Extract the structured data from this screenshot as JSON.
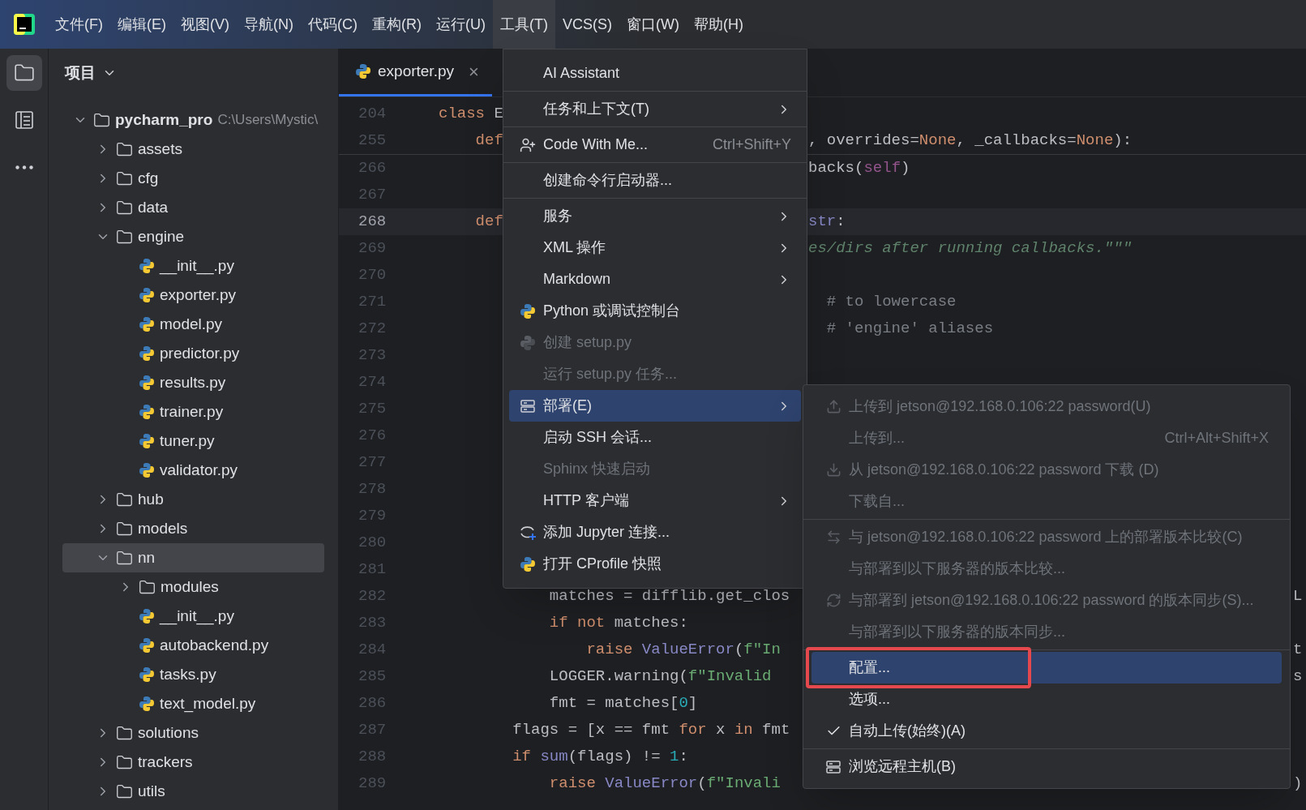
{
  "menubar": {
    "items": [
      {
        "label": "文件(F)",
        "selected": false
      },
      {
        "label": "编辑(E)",
        "selected": false
      },
      {
        "label": "视图(V)",
        "selected": false
      },
      {
        "label": "导航(N)",
        "selected": false
      },
      {
        "label": "代码(C)",
        "selected": false
      },
      {
        "label": "重构(R)",
        "selected": false
      },
      {
        "label": "运行(U)",
        "selected": false
      },
      {
        "label": "工具(T)",
        "selected": true
      },
      {
        "label": "VCS(S)",
        "selected": false
      },
      {
        "label": "窗口(W)",
        "selected": false
      },
      {
        "label": "帮助(H)",
        "selected": false
      }
    ]
  },
  "toolstrip": [
    {
      "kind": "folder",
      "selected": true
    },
    {
      "kind": "structure",
      "selected": false
    },
    {
      "kind": "more",
      "selected": false
    }
  ],
  "project": {
    "title": "项目",
    "tree": [
      {
        "name": "pycharm_pro",
        "path": "C:\\Users\\Mystic\\",
        "kind": "root",
        "expanded": true,
        "selected": false,
        "children": [
          {
            "name": "assets",
            "kind": "folder",
            "expanded": false,
            "selected": false
          },
          {
            "name": "cfg",
            "kind": "folder",
            "expanded": false,
            "selected": false
          },
          {
            "name": "data",
            "kind": "folder",
            "expanded": false,
            "selected": false
          },
          {
            "name": "engine",
            "kind": "folder",
            "expanded": true,
            "selected": false,
            "children": [
              {
                "name": "__init__.py",
                "kind": "file",
                "selected": false
              },
              {
                "name": "exporter.py",
                "kind": "file",
                "selected": false
              },
              {
                "name": "model.py",
                "kind": "file",
                "selected": false
              },
              {
                "name": "predictor.py",
                "kind": "file",
                "selected": false
              },
              {
                "name": "results.py",
                "kind": "file",
                "selected": false
              },
              {
                "name": "trainer.py",
                "kind": "file",
                "selected": false
              },
              {
                "name": "tuner.py",
                "kind": "file",
                "selected": false
              },
              {
                "name": "validator.py",
                "kind": "file",
                "selected": false
              }
            ]
          },
          {
            "name": "hub",
            "kind": "folder",
            "expanded": false,
            "selected": false
          },
          {
            "name": "models",
            "kind": "folder",
            "expanded": false,
            "selected": false
          },
          {
            "name": "nn",
            "kind": "folder",
            "expanded": true,
            "selected": true,
            "children": [
              {
                "name": "modules",
                "kind": "folder",
                "expanded": false,
                "selected": false
              },
              {
                "name": "__init__.py",
                "kind": "file",
                "selected": false
              },
              {
                "name": "autobackend.py",
                "kind": "file",
                "selected": false
              },
              {
                "name": "tasks.py",
                "kind": "file",
                "selected": false
              },
              {
                "name": "text_model.py",
                "kind": "file",
                "selected": false
              }
            ]
          },
          {
            "name": "solutions",
            "kind": "folder",
            "expanded": false,
            "selected": false
          },
          {
            "name": "trackers",
            "kind": "folder",
            "expanded": false,
            "selected": false
          },
          {
            "name": "utils",
            "kind": "folder",
            "expanded": false,
            "selected": false
          }
        ]
      }
    ]
  },
  "tabs": [
    {
      "label": "exporter.py",
      "selected": true,
      "close": "×"
    }
  ],
  "editor": {
    "lines": [
      {
        "number": "204",
        "current": false,
        "left": [
          {
            "text": "class ",
            "kind": "kw"
          },
          {
            "text": "E",
            "kind": "plain"
          }
        ]
      },
      {
        "number": "255",
        "current": false,
        "left": [
          {
            "text": "    def",
            "kind": "kw"
          }
        ],
        "right": [
          {
            "text": ", overrides=",
            "kind": "plain"
          },
          {
            "text": "None",
            "kind": "kw"
          },
          {
            "text": ", _callbacks=",
            "kind": "plain"
          },
          {
            "text": "None",
            "kind": "kw"
          },
          {
            "text": "):",
            "kind": "plain"
          }
        ]
      },
      {
        "number": "266",
        "current": false,
        "right": [
          {
            "text": "backs(",
            "kind": "plain"
          },
          {
            "text": "self",
            "kind": "self"
          },
          {
            "text": ")",
            "kind": "plain"
          }
        ]
      },
      {
        "number": "267",
        "current": false
      },
      {
        "number": "268",
        "current": true,
        "left": [
          {
            "text": "    def",
            "kind": "kw"
          }
        ],
        "right": [
          {
            "text": "str",
            "kind": "builtin"
          },
          {
            "text": ":",
            "kind": "plain"
          }
        ]
      },
      {
        "number": "269",
        "current": false,
        "right": [
          {
            "text": "es/dirs after running callbacks.\"\"\"",
            "kind": "doc"
          }
        ]
      },
      {
        "number": "270",
        "current": false
      },
      {
        "number": "271",
        "current": false,
        "right": [
          {
            "text": "  # to lowercase",
            "kind": "comment"
          }
        ]
      },
      {
        "number": "272",
        "current": false,
        "right": [
          {
            "text": "  # 'engine' aliases",
            "kind": "comment"
          }
        ]
      },
      {
        "number": "273",
        "current": false
      },
      {
        "number": "274",
        "current": false
      },
      {
        "number": "275",
        "current": false
      },
      {
        "number": "276",
        "current": false
      },
      {
        "number": "277",
        "current": false
      },
      {
        "number": "278",
        "current": false
      },
      {
        "number": "279",
        "current": false
      },
      {
        "number": "280",
        "current": false
      },
      {
        "number": "281",
        "current": false
      },
      {
        "number": "282",
        "current": false,
        "left": [
          {
            "text": "            matches = difflib.get_clos",
            "kind": "plain"
          }
        ],
        "far": [
          {
            "text": "L"
          }
        ]
      },
      {
        "number": "283",
        "current": false,
        "left": [
          {
            "text": "            if not",
            "kind": "kw"
          },
          {
            "text": " matches:",
            "kind": "plain"
          }
        ]
      },
      {
        "number": "284",
        "current": false,
        "left": [
          {
            "text": "                raise ",
            "kind": "kw"
          },
          {
            "text": "ValueError",
            "kind": "builtin"
          },
          {
            "text": "(",
            "kind": "plain"
          },
          {
            "text": "f\"In",
            "kind": "str"
          }
        ],
        "far": [
          {
            "text": "t"
          }
        ]
      },
      {
        "number": "285",
        "current": false,
        "left": [
          {
            "text": "            LOGGER.warning(",
            "kind": "plain"
          },
          {
            "text": "f\"Invalid ",
            "kind": "str"
          }
        ],
        "far": [
          {
            "text": "s"
          }
        ]
      },
      {
        "number": "286",
        "current": false,
        "left": [
          {
            "text": "            fmt = matches[",
            "kind": "plain"
          },
          {
            "text": "0",
            "kind": "num"
          },
          {
            "text": "]",
            "kind": "plain"
          }
        ]
      },
      {
        "number": "287",
        "current": false,
        "left": [
          {
            "text": "        flags = [x == fmt ",
            "kind": "plain"
          },
          {
            "text": "for",
            "kind": "kw"
          },
          {
            "text": " x ",
            "kind": "plain"
          },
          {
            "text": "in",
            "kind": "kw"
          },
          {
            "text": " fmt",
            "kind": "plain"
          }
        ]
      },
      {
        "number": "288",
        "current": false,
        "left": [
          {
            "text": "        if ",
            "kind": "kw"
          },
          {
            "text": "sum",
            "kind": "builtin"
          },
          {
            "text": "(flags) != ",
            "kind": "plain"
          },
          {
            "text": "1",
            "kind": "num"
          },
          {
            "text": ":",
            "kind": "plain"
          }
        ]
      },
      {
        "number": "289",
        "current": false,
        "left": [
          {
            "text": "            raise ",
            "kind": "kw"
          },
          {
            "text": "ValueError",
            "kind": "builtin"
          },
          {
            "text": "(",
            "kind": "plain"
          },
          {
            "text": "f\"Invali",
            "kind": "str"
          }
        ],
        "far": [
          {
            "text": ")"
          }
        ]
      }
    ]
  },
  "tools_menu": {
    "items": [
      {
        "kind": "plain",
        "label": "AI Assistant",
        "submenu": false,
        "disabled": false,
        "selected": false
      },
      {
        "kind": "separator"
      },
      {
        "kind": "plain",
        "label": "任务和上下文(T)",
        "submenu": true,
        "disabled": false,
        "selected": false
      },
      {
        "kind": "separator"
      },
      {
        "kind": "person",
        "label": "Code With Me...",
        "shortcut": "Ctrl+Shift+Y",
        "submenu": false,
        "disabled": false,
        "selected": false
      },
      {
        "kind": "separator"
      },
      {
        "kind": "plain",
        "label": "创建命令行启动器...",
        "submenu": false,
        "disabled": false,
        "selected": false
      },
      {
        "kind": "separator"
      },
      {
        "kind": "plain",
        "label": "服务",
        "submenu": true,
        "disabled": false,
        "selected": false
      },
      {
        "kind": "plain",
        "label": "XML 操作",
        "submenu": true,
        "disabled": false,
        "selected": false
      },
      {
        "kind": "plain",
        "label": "Markdown",
        "submenu": true,
        "disabled": false,
        "selected": false
      },
      {
        "kind": "python",
        "label": "Python 或调试控制台",
        "submenu": false,
        "disabled": false,
        "selected": false
      },
      {
        "kind": "python",
        "label": "创建 setup.py",
        "submenu": false,
        "disabled": true,
        "selected": false
      },
      {
        "kind": "plain",
        "label": "运行 setup.py 任务...",
        "submenu": false,
        "disabled": true,
        "selected": false
      },
      {
        "kind": "server",
        "label": "部署(E)",
        "submenu": true,
        "disabled": false,
        "selected": true
      },
      {
        "kind": "plain",
        "label": "启动 SSH 会话...",
        "submenu": false,
        "disabled": false,
        "selected": false
      },
      {
        "kind": "plain",
        "label": "Sphinx 快速启动",
        "submenu": false,
        "disabled": true,
        "selected": false
      },
      {
        "kind": "plain",
        "label": "HTTP 客户端",
        "submenu": true,
        "disabled": false,
        "selected": false
      },
      {
        "kind": "jupyter",
        "label": "添加 Jupyter 连接...",
        "submenu": false,
        "disabled": false,
        "selected": false
      },
      {
        "kind": "profile",
        "label": "打开 CProfile 快照",
        "submenu": false,
        "disabled": false,
        "selected": false
      }
    ]
  },
  "deploy_menu": {
    "items": [
      {
        "kind": "upload",
        "label": "上传到 jetson@192.168.0.106:22 password(U)",
        "disabled": true,
        "selected": false
      },
      {
        "kind": "plain",
        "label": "上传到...",
        "shortcut": "Ctrl+Alt+Shift+X",
        "disabled": true,
        "selected": false
      },
      {
        "kind": "download",
        "label": "从 jetson@192.168.0.106:22 password 下载 (D)",
        "disabled": true,
        "selected": false
      },
      {
        "kind": "plain",
        "label": "下载自...",
        "disabled": true,
        "selected": false
      },
      {
        "kind": "separator"
      },
      {
        "kind": "compare",
        "label": "与 jetson@192.168.0.106:22 password 上的部署版本比较(C)",
        "disabled": true,
        "selected": false
      },
      {
        "kind": "plain",
        "label": "与部署到以下服务器的版本比较...",
        "disabled": true,
        "selected": false
      },
      {
        "kind": "sync",
        "label": "与部署到 jetson@192.168.0.106:22 password 的版本同步(S)...",
        "disabled": true,
        "selected": false
      },
      {
        "kind": "plain",
        "label": "与部署到以下服务器的版本同步...",
        "disabled": true,
        "selected": false
      },
      {
        "kind": "separator"
      },
      {
        "kind": "plain",
        "label": "配置...",
        "disabled": false,
        "selected": true,
        "highlighted": true
      },
      {
        "kind": "plain",
        "label": "选项...",
        "disabled": false,
        "selected": false
      },
      {
        "kind": "plain",
        "label": "自动上传(始终)(A)",
        "disabled": false,
        "selected": false,
        "checked": true
      },
      {
        "kind": "separator"
      },
      {
        "kind": "server",
        "label": "浏览远程主机(B)",
        "disabled": false,
        "selected": false
      }
    ]
  }
}
